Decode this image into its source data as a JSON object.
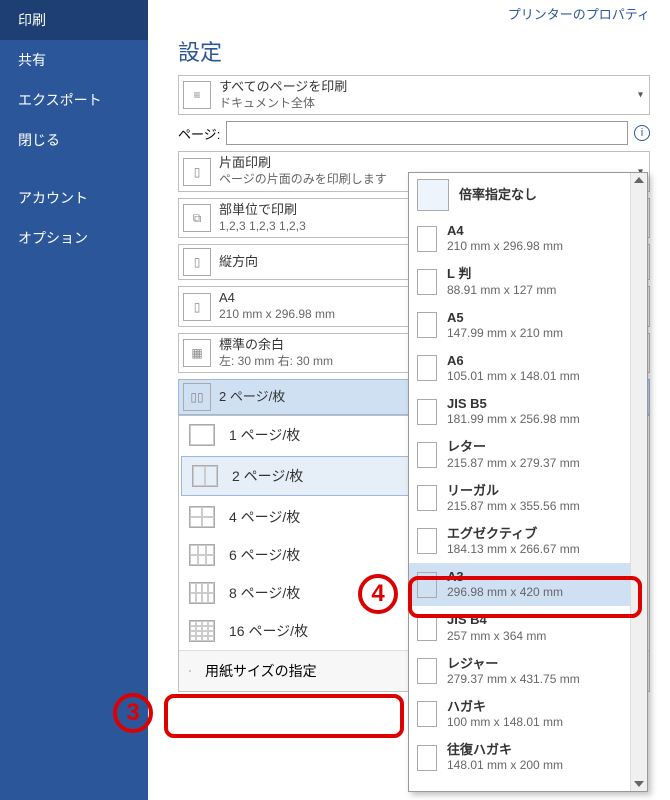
{
  "sidebar": {
    "items": [
      {
        "label": "印刷",
        "active": true
      },
      {
        "label": "共有"
      },
      {
        "label": "エクスポート"
      },
      {
        "label": "閉じる"
      }
    ],
    "lower": [
      {
        "label": "アカウント"
      },
      {
        "label": "オプション"
      }
    ]
  },
  "printer_props_link": "プリンターのプロパティ",
  "section_title": "設定",
  "page_label": "ページ:",
  "page_value": "",
  "settings": [
    {
      "title": "すべてのページを印刷",
      "sub": "ドキュメント全体",
      "icon": "pages"
    },
    {
      "title": "片面印刷",
      "sub": "ページの片面のみを印刷します",
      "icon": "page"
    },
    {
      "title": "部単位で印刷",
      "sub": "1,2,3    1,2,3    1,2,3",
      "icon": "collate"
    },
    {
      "title": "縦方向",
      "sub": "",
      "icon": "portrait"
    },
    {
      "title": "A4",
      "sub": "210 mm x 296.98 mm",
      "icon": "paper"
    },
    {
      "title": "標準の余白",
      "sub": "左:  30 mm    右:  30 mm",
      "icon": "margins"
    },
    {
      "title": "2 ページ/枚",
      "sub": "",
      "icon": "2up",
      "selected": true
    }
  ],
  "pps": {
    "items": [
      {
        "label": "1 ページ/枚",
        "grid": "g1"
      },
      {
        "label": "2 ページ/枚",
        "grid": "g2",
        "selected": true
      },
      {
        "label": "4 ページ/枚",
        "grid": "g4"
      },
      {
        "label": "6 ページ/枚",
        "grid": "g6"
      },
      {
        "label": "8 ページ/枚",
        "grid": "g8"
      },
      {
        "label": "16 ページ/枚",
        "grid": "g16"
      }
    ],
    "more_label": "用紙サイズの指定"
  },
  "flyout": {
    "items": [
      {
        "title": "倍率指定なし",
        "sub": "",
        "big": true
      },
      {
        "title": "A4",
        "sub": "210 mm x 296.98 mm"
      },
      {
        "title": "L 判",
        "sub": "88.91 mm x 127 mm"
      },
      {
        "title": "A5",
        "sub": "147.99 mm x 210 mm"
      },
      {
        "title": "A6",
        "sub": "105.01 mm x 148.01 mm"
      },
      {
        "title": "JIS B5",
        "sub": "181.99 mm x 256.98 mm"
      },
      {
        "title": "レター",
        "sub": "215.87 mm x 279.37 mm"
      },
      {
        "title": "リーガル",
        "sub": "215.87 mm x 355.56 mm"
      },
      {
        "title": "エグゼクティブ",
        "sub": "184.13 mm x 266.67 mm"
      },
      {
        "title": "A3",
        "sub": "296.98 mm x 420 mm",
        "selected": true
      },
      {
        "title": "JIS B4",
        "sub": "257 mm x 364 mm"
      },
      {
        "title": "レジャー",
        "sub": "279.37 mm x 431.75 mm"
      },
      {
        "title": "ハガキ",
        "sub": "100 mm x 148.01 mm"
      },
      {
        "title": "往復ハガキ",
        "sub": "148.01 mm x 200 mm"
      }
    ]
  },
  "annotations": {
    "n3": "3",
    "n4": "4"
  }
}
